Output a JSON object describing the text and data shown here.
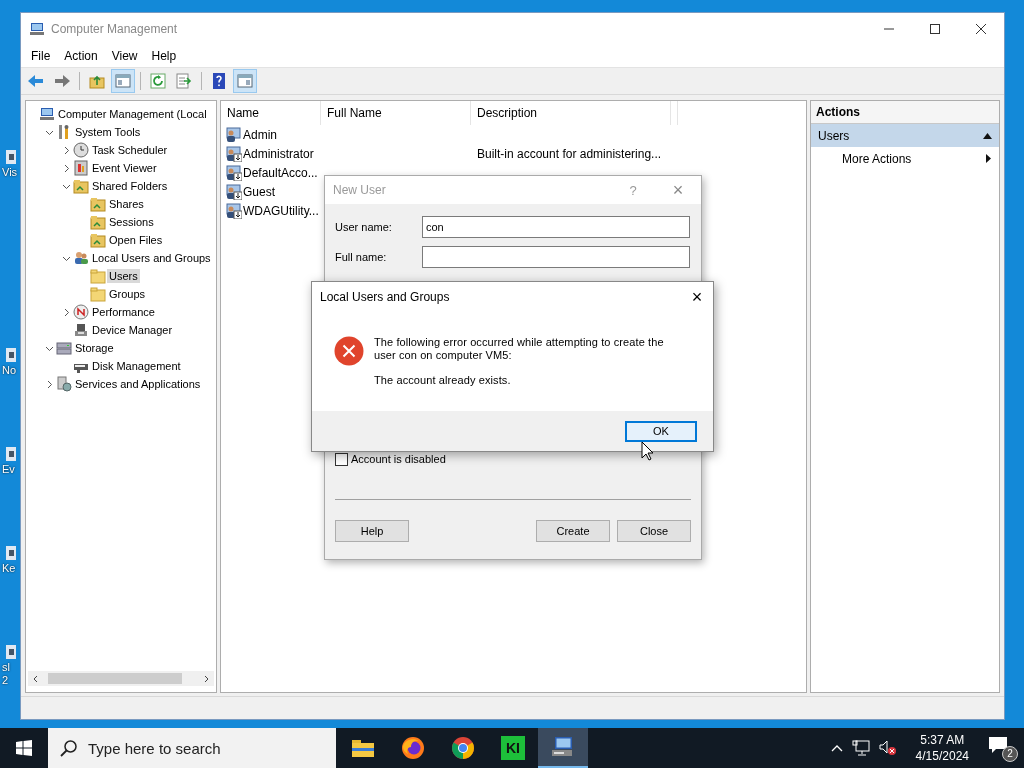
{
  "desktop_icons": [
    {
      "lines": [
        "Vis"
      ]
    },
    {
      "lines": [
        "No"
      ]
    },
    {
      "lines": [
        "Ev"
      ]
    },
    {
      "lines": [
        "Ke"
      ]
    },
    {
      "lines": [
        "sl",
        "2"
      ]
    }
  ],
  "window": {
    "title": "Computer Management"
  },
  "menu": [
    "File",
    "Action",
    "View",
    "Help"
  ],
  "toolbar": [
    {
      "kind": "back",
      "on": false
    },
    {
      "kind": "forward",
      "on": false
    },
    {
      "kind": "sep"
    },
    {
      "kind": "up",
      "on": false
    },
    {
      "kind": "tree",
      "on": true
    },
    {
      "kind": "sep"
    },
    {
      "kind": "refresh",
      "on": false
    },
    {
      "kind": "export",
      "on": false
    },
    {
      "kind": "sep"
    },
    {
      "kind": "help",
      "on": false
    },
    {
      "kind": "actionpane",
      "on": true
    }
  ],
  "tree": {
    "items": [
      {
        "label": "Computer Management (Local",
        "kind": "computer",
        "selected": false,
        "children": [
          {
            "label": "System Tools",
            "kind": "tools",
            "selected": false,
            "expanded": true,
            "children": [
              {
                "label": "Task Scheduler",
                "kind": "clock",
                "selected": false,
                "expanded": false
              },
              {
                "label": "Event Viewer",
                "kind": "event",
                "selected": false,
                "expanded": false
              },
              {
                "label": "Shared Folders",
                "kind": "share",
                "selected": false,
                "expanded": true,
                "children": [
                  {
                    "label": "Shares",
                    "kind": "share",
                    "selected": false
                  },
                  {
                    "label": "Sessions",
                    "kind": "share",
                    "selected": false
                  },
                  {
                    "label": "Open Files",
                    "kind": "share",
                    "selected": false
                  }
                ]
              },
              {
                "label": "Local Users and Groups",
                "kind": "users",
                "selected": false,
                "expanded": true,
                "children": [
                  {
                    "label": "Users",
                    "kind": "folder",
                    "selected": true
                  },
                  {
                    "label": "Groups",
                    "kind": "folder",
                    "selected": false
                  }
                ]
              },
              {
                "label": "Performance",
                "kind": "perf",
                "selected": false,
                "expanded": false
              },
              {
                "label": "Device Manager",
                "kind": "device",
                "selected": false
              }
            ]
          },
          {
            "label": "Storage",
            "kind": "storage",
            "selected": false,
            "expanded": true,
            "children": [
              {
                "label": "Disk Management",
                "kind": "disk",
                "selected": false
              }
            ]
          },
          {
            "label": "Services and Applications",
            "kind": "services",
            "selected": false,
            "expanded": false
          }
        ]
      }
    ]
  },
  "table": {
    "columns": [
      "Name",
      "Full Name",
      "Description"
    ],
    "rows": [
      {
        "name": "Admin",
        "full_name": "",
        "description": "",
        "disabled": false
      },
      {
        "name": "Administrator",
        "full_name": "",
        "description": "Built-in account for administering...",
        "disabled": true
      },
      {
        "name": "DefaultAcco...",
        "full_name": "",
        "description": "",
        "disabled": true
      },
      {
        "name": "Guest",
        "full_name": "",
        "description": "",
        "disabled": true
      },
      {
        "name": "WDAGUtility...",
        "full_name": "",
        "description": "",
        "disabled": true
      }
    ]
  },
  "actions": {
    "title": "Actions",
    "section": "Users",
    "items": [
      "More Actions"
    ]
  },
  "new_user_dialog": {
    "title": "New User",
    "help": "?",
    "close": "×",
    "fields": [
      {
        "label": "User name:",
        "value": "con"
      },
      {
        "label": "Full name:"
      }
    ],
    "checkbox": {
      "label": "Account is disabled",
      "checked": false
    },
    "buttons": [
      "Help",
      "Create",
      "Close"
    ]
  },
  "error_dialog": {
    "title": "Local Users and Groups",
    "close": "×",
    "message": "The following error occurred while attempting to create the user con on computer VM5:",
    "detail": "The account already exists.",
    "button": "OK"
  },
  "taskbar": {
    "search_placeholder": "Type here to search",
    "apps": [
      {
        "kind": "explorer",
        "active": false
      },
      {
        "kind": "firefox",
        "active": false
      },
      {
        "kind": "chrome",
        "active": false
      },
      {
        "kind": "ki",
        "label": "KI",
        "active": false
      },
      {
        "kind": "compmgmt",
        "active": true
      }
    ],
    "time": "5:37 AM",
    "date": "4/15/2024",
    "notifications": "2"
  }
}
